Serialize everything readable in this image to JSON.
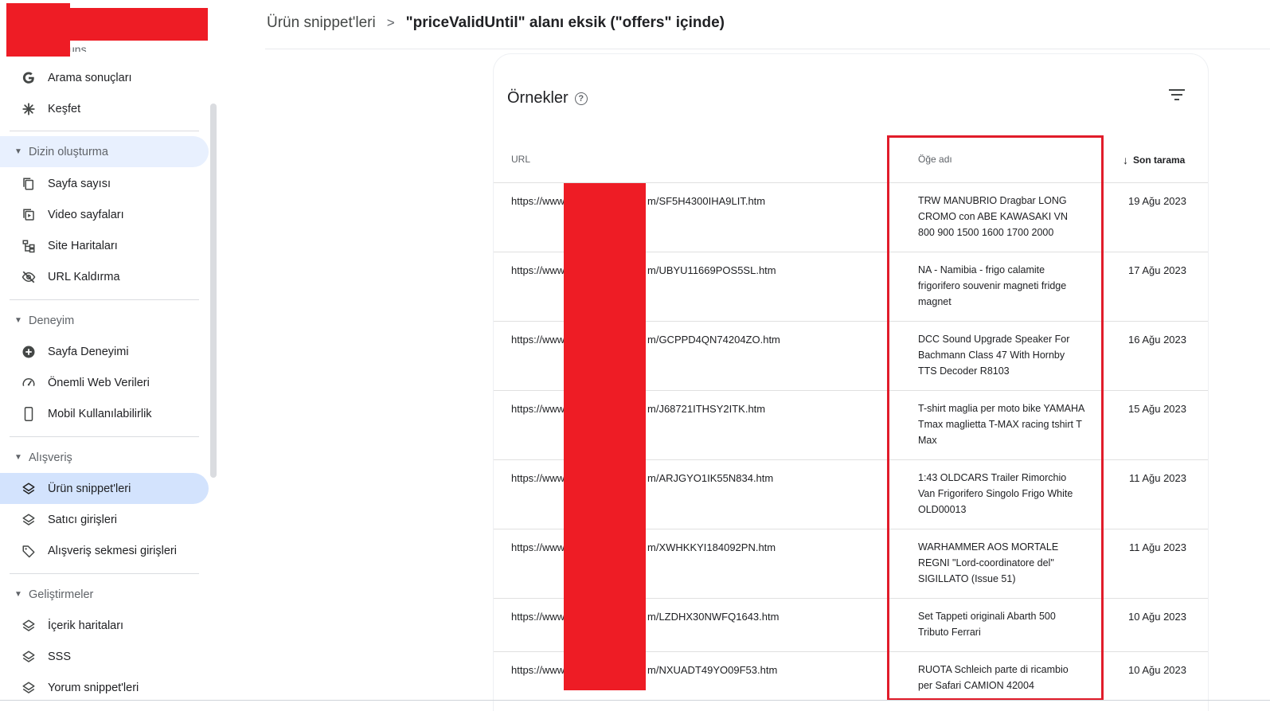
{
  "sidebar": {
    "peek_text": "uns",
    "top_items": [
      {
        "label": "Arama sonuçları",
        "icon": "google-g-icon"
      },
      {
        "label": "Keşfet",
        "icon": "asterisk-icon"
      }
    ],
    "sections": [
      {
        "title": "Dizin oluşturma",
        "items": [
          {
            "label": "Sayfa sayısı",
            "icon": "pages-icon"
          },
          {
            "label": "Video sayfaları",
            "icon": "video-page-icon"
          },
          {
            "label": "Site Haritaları",
            "icon": "sitemap-icon"
          },
          {
            "label": "URL Kaldırma",
            "icon": "eye-off-icon"
          }
        ]
      },
      {
        "title": "Deneyim",
        "items": [
          {
            "label": "Sayfa Deneyimi",
            "icon": "plus-circle-icon"
          },
          {
            "label": "Önemli Web Verileri",
            "icon": "gauge-icon"
          },
          {
            "label": "Mobil Kullanılabilirlik",
            "icon": "phone-icon"
          }
        ]
      },
      {
        "title": "Alışveriş",
        "items": [
          {
            "label": "Ürün snippet'leri",
            "icon": "layers-icon",
            "active": true
          },
          {
            "label": "Satıcı girişleri",
            "icon": "layers-icon"
          },
          {
            "label": "Alışveriş sekmesi girişleri",
            "icon": "tag-icon"
          }
        ]
      },
      {
        "title": "Geliştirmeler",
        "items": [
          {
            "label": "İçerik haritaları",
            "icon": "layers-icon"
          },
          {
            "label": "SSS",
            "icon": "layers-icon"
          },
          {
            "label": "Yorum snippet'leri",
            "icon": "layers-icon"
          }
        ]
      }
    ]
  },
  "header": {
    "breadcrumb_parent": "Ürün snippet'leri",
    "breadcrumb_separator": ">",
    "title": "\"priceValidUntil\" alanı eksik (\"offers\" içinde)"
  },
  "card": {
    "title": "Örnekler",
    "help": "?"
  },
  "table": {
    "headers": {
      "url": "URL",
      "name": "Öğe adı",
      "date": "Son tarama"
    },
    "sort_arrow": "↓",
    "rows": [
      {
        "url_start": "https://www",
        "url_end": "m/SF5H4300IHA9LIT.htm",
        "name": "TRW MANUBRIO Dragbar LONG CROMO con ABE KAWASAKI VN 800 900 1500 1600 1700 2000",
        "date": "19 Ağu 2023"
      },
      {
        "url_start": "https://www",
        "url_end": "m/UBYU11669POS5SL.htm",
        "name": "NA - Namibia - frigo calamite frigorifero souvenir magneti fridge magnet",
        "date": "17 Ağu 2023"
      },
      {
        "url_start": "https://www",
        "url_end": "m/GCPPD4QN74204ZO.htm",
        "name": "DCC Sound Upgrade Speaker For Bachmann Class 47 With Hornby TTS Decoder R8103",
        "date": "16 Ağu 2023"
      },
      {
        "url_start": "https://www",
        "url_end": "m/J68721ITHSY2ITK.htm",
        "name": "T-shirt maglia per moto bike YAMAHA Tmax maglietta T-MAX racing tshirt T Max",
        "date": "15 Ağu 2023"
      },
      {
        "url_start": "https://www",
        "url_end": "m/ARJGYO1IK55N834.htm",
        "name": "1:43 OLDCARS Trailer Rimorchio Van Frigorifero Singolo Frigo White OLD00013",
        "date": "11 Ağu 2023"
      },
      {
        "url_start": "https://www",
        "url_end": "m/XWHKKYI184092PN.htm",
        "name": "WARHAMMER AOS MORTALE REGNI \"Lord-coordinatore del\" SIGILLATO (Issue 51)",
        "date": "11 Ağu 2023"
      },
      {
        "url_start": "https://www",
        "url_end": "m/LZDHX30NWFQ1643.htm",
        "name": "Set Tappeti originali Abarth 500 Tributo Ferrari",
        "date": "10 Ağu 2023"
      },
      {
        "url_start": "https://www",
        "url_end": "m/NXUADT49YO09F53.htm",
        "name": "RUOTA Schleich parte di ricambio per Safari CAMION 42004",
        "date": "10 Ağu 2023"
      }
    ]
  }
}
